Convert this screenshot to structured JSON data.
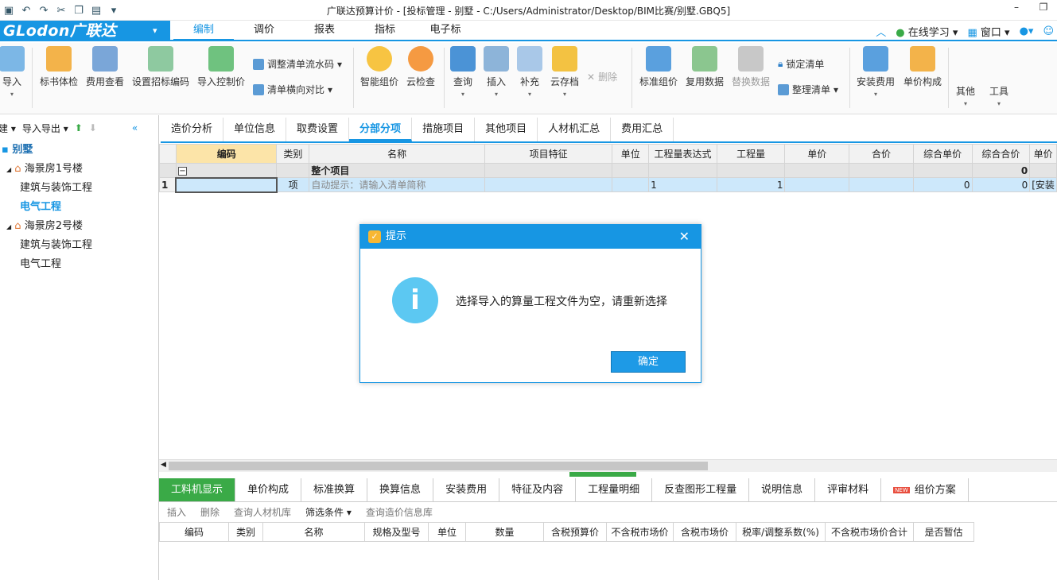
{
  "window": {
    "title": "广联达预算计价 - [投标管理 - 别墅 - C:/Users/Administrator/Desktop/BIM比赛/别墅.GBQ5]"
  },
  "logo": {
    "text": "GLodon广联达",
    "dropdown": "▾"
  },
  "menu": {
    "tabs": [
      "编制",
      "调价",
      "报表",
      "指标",
      "电子标"
    ],
    "right": {
      "learn": "在线学习",
      "window": "窗口"
    }
  },
  "ribbon": {
    "import": "导入",
    "check": "标书体检",
    "fee_view": "费用查看",
    "set_code": "设置招标编码",
    "import_ctrl": "导入控制价",
    "adjust_flow": "调整清单流水码",
    "compare": "清单横向对比",
    "smart_price": "智能组价",
    "cloud_check": "云检查",
    "query": "查询",
    "insert": "插入",
    "supplement": "补充",
    "cloud_save": "云存档",
    "delete": "删除",
    "std_price": "标准组价",
    "reuse": "复用数据",
    "replace": "替换数据",
    "lock": "锁定清单",
    "organize": "整理清单",
    "install_fee": "安装费用",
    "unit_compose": "单价构成",
    "other": "其他",
    "tools": "工具"
  },
  "left": {
    "new": "新建",
    "import_export": "导入导出",
    "project": "别墅",
    "tree": [
      {
        "label": "海景房1号楼",
        "level": 1
      },
      {
        "label": "建筑与装饰工程",
        "level": 2
      },
      {
        "label": "电气工程",
        "level": 2,
        "selected": true
      },
      {
        "label": "海景房2号楼",
        "level": 1
      },
      {
        "label": "建筑与装饰工程",
        "level": 2
      },
      {
        "label": "电气工程",
        "level": 2
      }
    ]
  },
  "tabs": [
    "造价分析",
    "单位信息",
    "取费设置",
    "分部分项",
    "措施项目",
    "其他项目",
    "人材机汇总",
    "费用汇总"
  ],
  "grid": {
    "headers": [
      "编码",
      "类别",
      "名称",
      "项目特征",
      "单位",
      "工程量表达式",
      "工程量",
      "单价",
      "合价",
      "综合单价",
      "综合合价",
      "单价"
    ],
    "group_row": {
      "collapse": "−",
      "name": "整个项目",
      "total": "0"
    },
    "rows": [
      {
        "no": "1",
        "code": "",
        "type": "项",
        "name": "自动提示：请输入清单简称",
        "expr": "1",
        "qty": "1",
        "unit_price": "0",
        "total": "0",
        "extra": "[安装"
      }
    ]
  },
  "bottom": {
    "tabs": [
      "工料机显示",
      "单价构成",
      "标准换算",
      "换算信息",
      "安装费用",
      "特征及内容",
      "工程量明细",
      "反查图形工程量",
      "说明信息",
      "评审材料",
      "组价方案"
    ],
    "new_badge": "NEW",
    "toolbar": [
      "插入",
      "删除",
      "查询人材机库",
      "筛选条件",
      "查询造价信息库"
    ],
    "headers": [
      "编码",
      "类别",
      "名称",
      "规格及型号",
      "单位",
      "数量",
      "含税预算价",
      "不含税市场价",
      "含税市场价",
      "税率/调整系数(%)",
      "不含税市场价合计",
      "是否暂估"
    ]
  },
  "dialog": {
    "title": "提示",
    "message": "选择导入的算量工程文件为空，请重新选择",
    "ok": "确定",
    "info_glyph": "i",
    "close": "✕"
  },
  "colors": {
    "accent": "#1796e3",
    "green": "#3aaa47",
    "header_highlight": "#fce4a8"
  }
}
